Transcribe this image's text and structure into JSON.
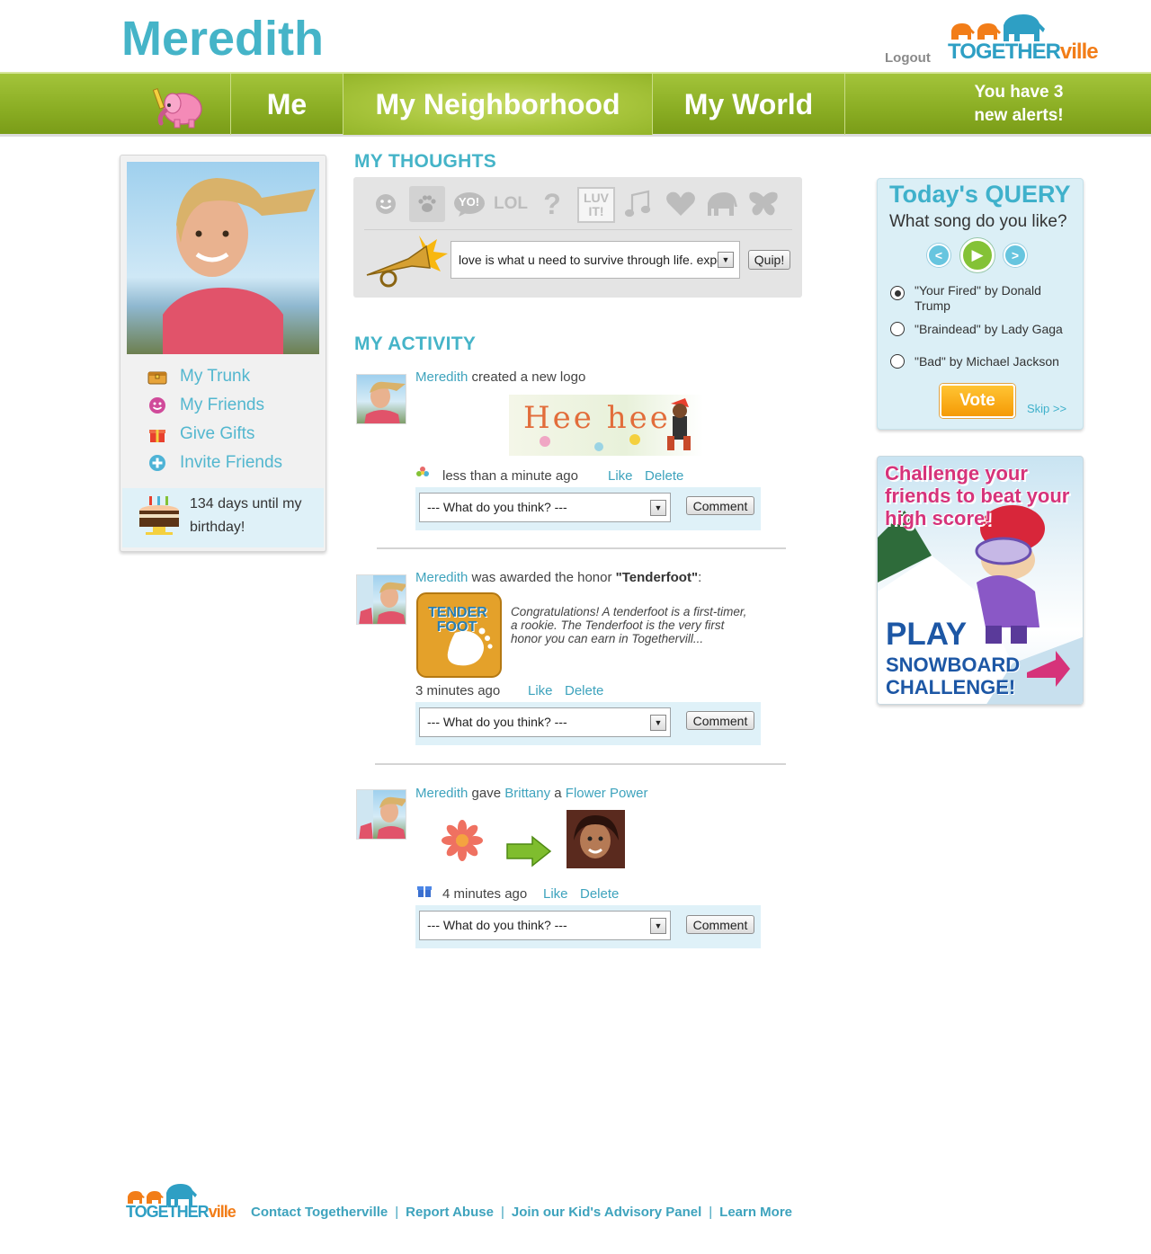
{
  "header": {
    "user_name": "Meredith",
    "logout_label": "Logout",
    "brand_left": "TOGETHER",
    "brand_right": "ville"
  },
  "nav": {
    "items": [
      {
        "label": "Me"
      },
      {
        "label": "My Neighborhood",
        "active": true
      },
      {
        "label": "My World"
      }
    ],
    "alerts_line1": "You have 3",
    "alerts_line2": "new alerts!"
  },
  "profile": {
    "menu": [
      {
        "label": "My Trunk",
        "icon": "trunk-icon"
      },
      {
        "label": "My Friends",
        "icon": "smiley-icon"
      },
      {
        "label": "Give Gifts",
        "icon": "gift-icon"
      },
      {
        "label": "Invite Friends",
        "icon": "plus-circle-icon"
      }
    ],
    "birthday_text": "134 days until my birthday!"
  },
  "thoughts": {
    "title": "MY THOUGHTS",
    "icons": [
      "smiley-icon",
      "paw-icon",
      "yo-icon",
      "lol-icon",
      "question-icon",
      "luv-it-icon",
      "music-note-icon",
      "heart-icon",
      "elephant-icon",
      "butterfly-icon"
    ],
    "icon_texts": {
      "yo": "YO!",
      "lol": "LOL",
      "question": "?",
      "luv_line1": "LUV",
      "luv_line2": "IT!"
    },
    "quip_value": "love is what u need to survive through life. expe",
    "quip_button": "Quip!"
  },
  "activity": {
    "title": "MY ACTIVITY",
    "comment_placeholder": "--- What do you think? ---",
    "comment_button": "Comment",
    "like_label": "Like",
    "delete_label": "Delete",
    "items": [
      {
        "actor": "Meredith",
        "verb": "created a new logo",
        "logo_text": "Hee hee",
        "time": "less than a minute ago"
      },
      {
        "actor": "Meredith",
        "verb": "was awarded the honor",
        "honor": "\"Tenderfoot\"",
        "honor_suffix": ":",
        "badge_line1": "TENDER",
        "badge_line2": "FOOT",
        "description": "Congratulations! A tenderfoot is a first-timer, a rookie. The Tenderfoot is the very first honor you can earn in Togethervill...",
        "time": "3 minutes ago"
      },
      {
        "actor": "Meredith",
        "verb": "gave",
        "recipient": "Brittany",
        "article": "a",
        "gift": "Flower Power",
        "time": "4 minutes ago"
      }
    ]
  },
  "query": {
    "title": "Today's QUERY",
    "question": "What song do you like?",
    "options": [
      {
        "label": "\"Your Fired\" by Donald Trump",
        "selected": true
      },
      {
        "label": "\"Braindead\" by Lady Gaga",
        "selected": false
      },
      {
        "label": "\"Bad\" by Michael Jackson",
        "selected": false
      }
    ],
    "vote_label": "Vote",
    "skip_label": "Skip >>"
  },
  "ad": {
    "headline": "Challenge your friends to beat your high score!",
    "play": "PLAY",
    "line1": "SNOWBOARD",
    "line2": "CHALLENGE!"
  },
  "footer": {
    "links": [
      "Contact Togetherville",
      "Report Abuse",
      "Join our Kid's Advisory Panel",
      "Learn More"
    ],
    "separator": "|"
  },
  "colors": {
    "accent_teal": "#45b4c8",
    "nav_green": "#8aad23",
    "vote_orange": "#f59a06",
    "panel_blue": "#dbeff6"
  }
}
